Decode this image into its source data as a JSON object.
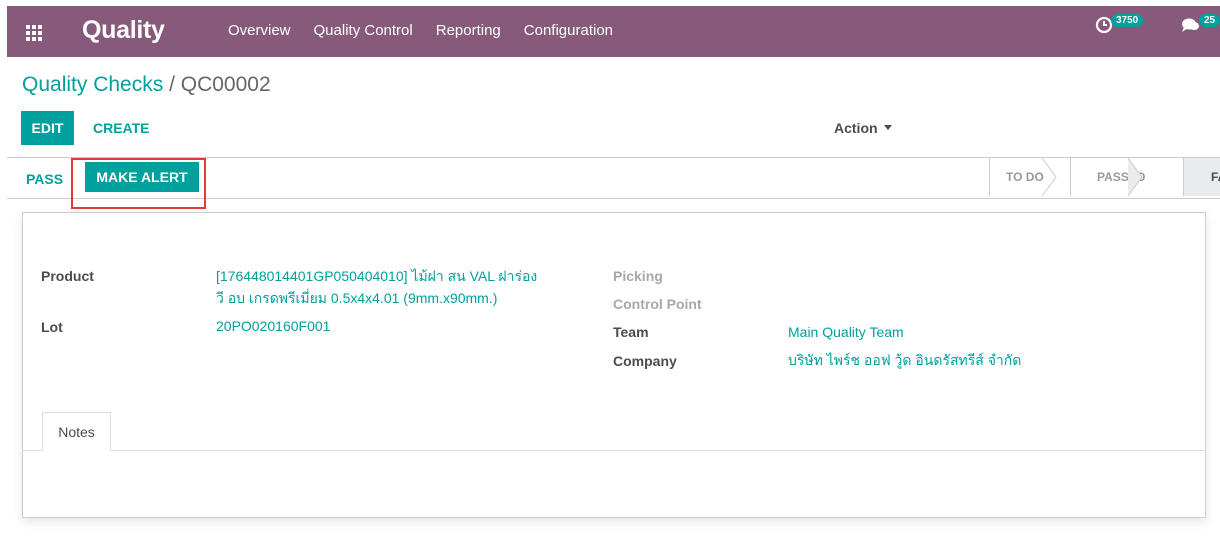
{
  "app": {
    "title": "Quality"
  },
  "menu": [
    "Overview",
    "Quality Control",
    "Reporting",
    "Configuration"
  ],
  "systray": {
    "activity_count": "3750",
    "messages_count": "25"
  },
  "breadcrumb": {
    "parent": "Quality Checks",
    "separator": "/",
    "current": "QC00002"
  },
  "control": {
    "edit": "EDIT",
    "create": "CREATE",
    "action": "Action"
  },
  "header": {
    "pass": "PASS",
    "make_alert": "MAKE ALERT"
  },
  "stages": [
    {
      "label": "TO DO",
      "active": false
    },
    {
      "label": "PASSED",
      "active": false
    },
    {
      "label": "FAILED",
      "active": true
    }
  ],
  "form": {
    "product_label": "Product",
    "product_line1": "[176448014401GP050404010] ไม้ฝา สน VAL ฝาร่อง",
    "product_line2": "วี อบ เกรดพรีเมี่ยม 0.5x4x4.01 (9mm.x90mm.)",
    "lot_label": "Lot",
    "lot_value": "20PO020160F001",
    "picking_label": "Picking",
    "control_point_label": "Control Point",
    "team_label": "Team",
    "team_value": "Main Quality Team",
    "company_label": "Company",
    "company_value": "บริษัท ไพร์ช ออฟ วู้ด อินดรัสทรีส์ จำกัด"
  },
  "tabs": {
    "notes": "Notes"
  },
  "colors": {
    "brand": "#875a7b",
    "accent": "#00a09d",
    "highlight": "#e53935"
  }
}
